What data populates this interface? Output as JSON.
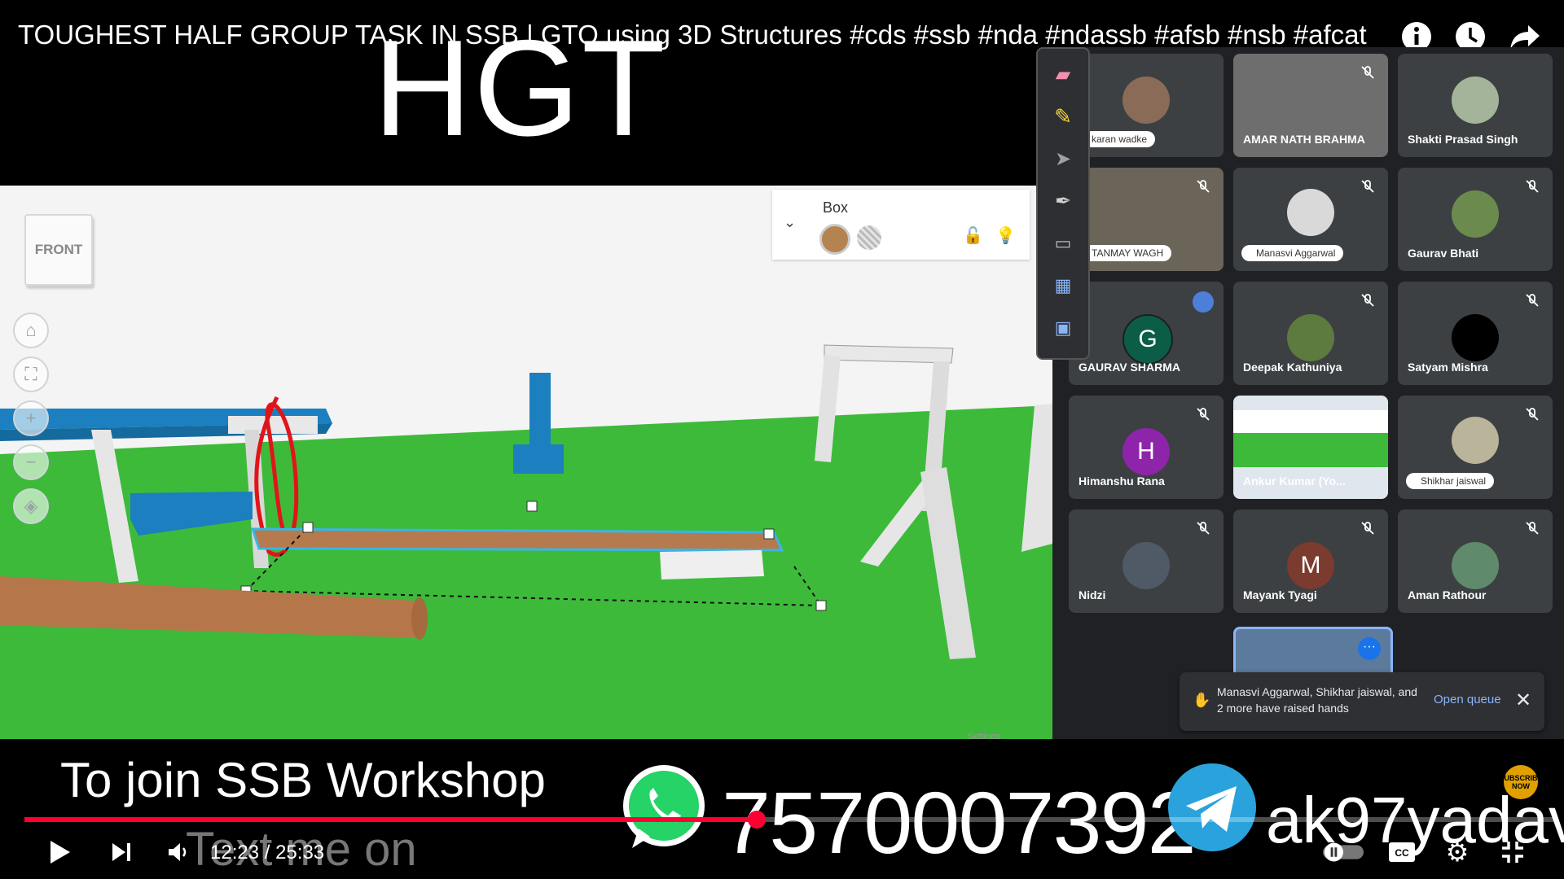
{
  "video": {
    "title": "TOUGHEST HALF GROUP TASK IN SSB | GTO using 3D Structures #cds #ssb #nda #ndassb #afsb #nsb #afcat",
    "overlay_heading": "HGT",
    "progress_fraction": 0.478,
    "time_current": "12:23",
    "time_separator": " / ",
    "time_total": "25:33"
  },
  "top_icons": [
    "info-icon",
    "clock-icon",
    "share-icon"
  ],
  "scene": {
    "viewcube_label": "FRONT",
    "inspector": {
      "title": "Box",
      "swatch_color": "#b5834f"
    },
    "nav_buttons": [
      "home-icon",
      "fit-view-icon",
      "zoom-in-icon",
      "zoom-out-icon",
      "perspective-icon"
    ],
    "ground_color": "#3dba3a",
    "accent_blue": "#1b7fc0",
    "plank_color": "#b57b4e",
    "settings_label": "Settings"
  },
  "meeting": {
    "participants": [
      {
        "name": "karan wadke",
        "style": "pill",
        "avatar": "photo"
      },
      {
        "name": "AMAR NATH BRAHMA",
        "style": "plain",
        "avatar": "video",
        "muted": true
      },
      {
        "name": "Shakti Prasad Singh",
        "style": "plain",
        "avatar": "photo"
      },
      {
        "name": "TANMAY WAGH",
        "style": "pill",
        "avatar": "video",
        "muted": true
      },
      {
        "name": "Manasvi Aggarwal",
        "style": "pill",
        "avatar": "photo",
        "muted": true
      },
      {
        "name": "Gaurav Bhati",
        "style": "plain",
        "avatar": "photo",
        "muted": true
      },
      {
        "name": "GAURAV SHARMA",
        "style": "plain",
        "avatar": "G",
        "avatar_color": "#0b5d48",
        "speaking": true
      },
      {
        "name": "Deepak Kathuniya",
        "style": "plain",
        "avatar": "photo",
        "muted": true
      },
      {
        "name": "Satyam Mishra",
        "style": "plain",
        "avatar": "black",
        "muted": true
      },
      {
        "name": "Himanshu Rana",
        "style": "plain",
        "avatar": "H",
        "avatar_color": "#8e24aa",
        "muted": true
      },
      {
        "name": "Ankur Kumar (Yo...",
        "style": "plain",
        "avatar": "screen"
      },
      {
        "name": "Shikhar jaiswal",
        "style": "pill",
        "avatar": "photo",
        "muted": true
      },
      {
        "name": "Nidzi",
        "style": "plain",
        "avatar": "photo",
        "muted": true
      },
      {
        "name": "Mayank Tyagi",
        "style": "plain",
        "avatar": "M",
        "avatar_color": "#7b3b2e",
        "muted": true
      },
      {
        "name": "Aman Rathour",
        "style": "plain",
        "avatar": "photo",
        "muted": true
      }
    ],
    "toast": {
      "text": "Manasvi Aggarwal, Shikhar jaiswal, and 2 more have raised hands",
      "action": "Open queue",
      "close": "✕"
    },
    "draw_tools": [
      "eraser-icon",
      "highlighter-icon",
      "pointer-icon",
      "pen-icon",
      "keyboard-icon",
      "screen-icon",
      "present-icon"
    ]
  },
  "promo": {
    "join_text": "To join SSB Workshop",
    "text_me": "Text me on",
    "phone": "7570007392",
    "telegram_handle": "ak97yadav",
    "subscribe_badge": "SUBSCRIBE NOW"
  },
  "controls": [
    "play-button",
    "next-button",
    "volume-button",
    "autoplay-toggle",
    "captions-button",
    "settings-button",
    "fullscreen-exit-button"
  ]
}
